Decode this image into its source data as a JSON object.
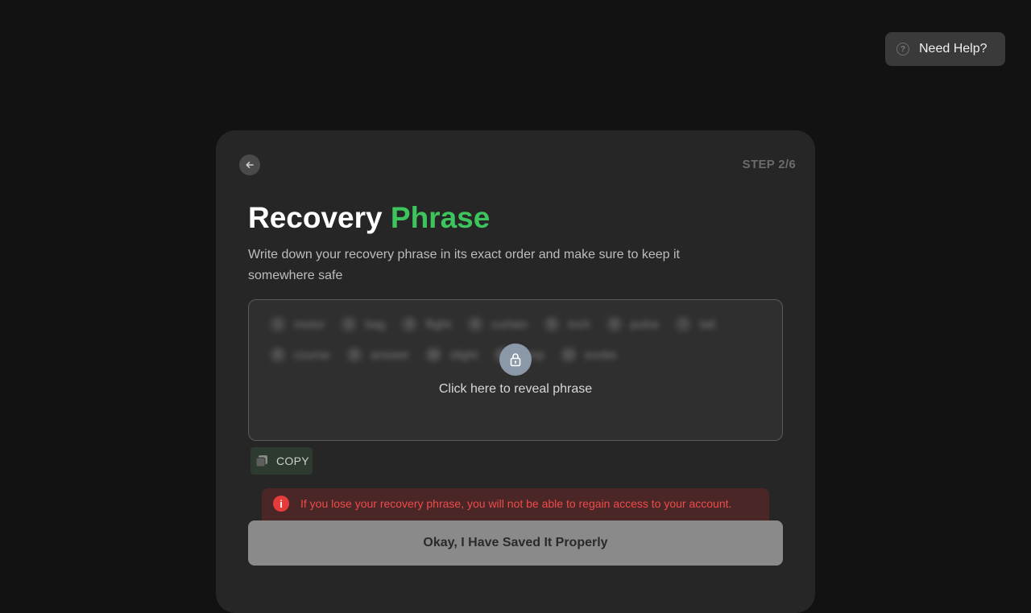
{
  "help": {
    "label": "Need Help?",
    "icon": "question-circle-icon"
  },
  "card": {
    "back_icon": "arrow-left-icon",
    "step": "STEP 2/6",
    "title_main": "Recovery",
    "title_accent": "Phrase",
    "accent_color": "#3ec45c",
    "subtitle": "Write down your recovery phrase in its exact order and make sure to keep it somewhere safe",
    "phrase": {
      "words": [
        {
          "num": "1",
          "word": "motor"
        },
        {
          "num": "2",
          "word": "bag"
        },
        {
          "num": "3",
          "word": "flight"
        },
        {
          "num": "4",
          "word": "curtain"
        },
        {
          "num": "5",
          "word": "inch"
        },
        {
          "num": "6",
          "word": "pulse"
        },
        {
          "num": "7",
          "word": "tail"
        },
        {
          "num": "8",
          "word": "course"
        },
        {
          "num": "9",
          "word": "answer"
        },
        {
          "num": "10",
          "word": "slight"
        },
        {
          "num": "11",
          "word": "lamp"
        },
        {
          "num": "12",
          "word": "evoke"
        }
      ],
      "reveal_text": "Click here to reveal phrase",
      "lock_icon": "lock-icon"
    },
    "copy_label": "COPY",
    "warning": "If you lose your recovery phrase, you will not be able to regain access to your account.",
    "warning_color": "#ef4b4b",
    "primary_button": "Okay, I Have Saved It Properly"
  }
}
